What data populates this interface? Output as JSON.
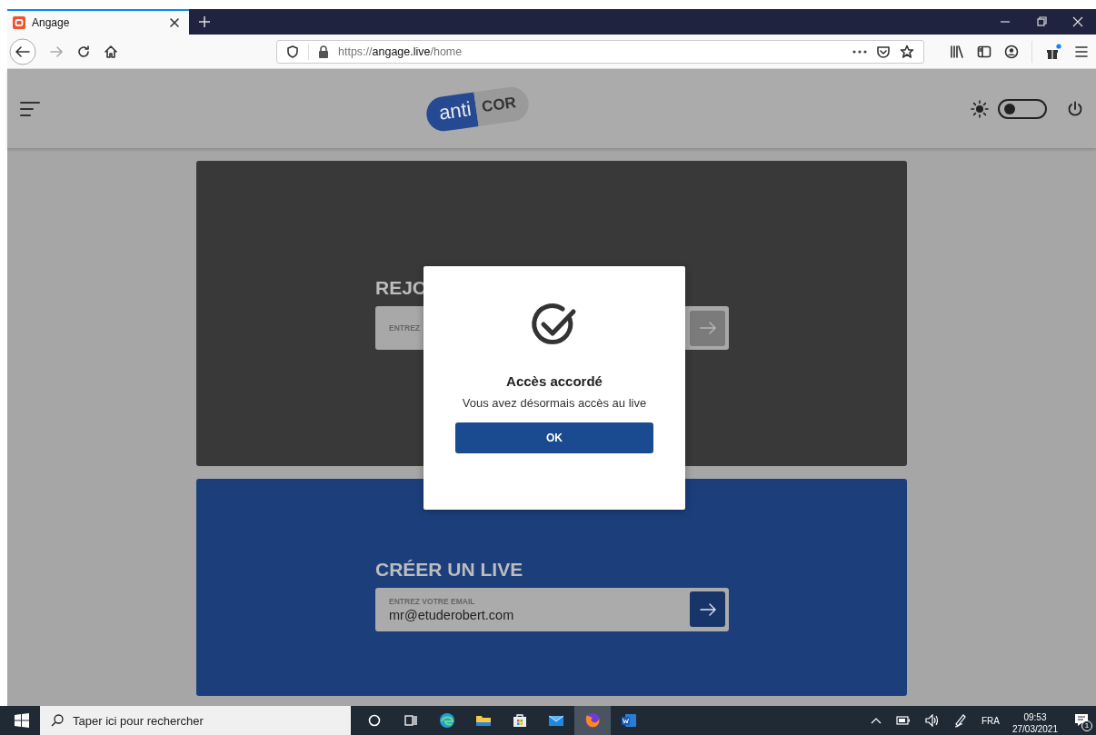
{
  "browser": {
    "tabs": [
      {
        "title": "Angage",
        "selected": true
      }
    ],
    "url": {
      "scheme": "https://",
      "host": "angage.live",
      "path": "/home"
    }
  },
  "app_header": {
    "logo": {
      "left": "anti",
      "right": "COR"
    },
    "theme_toggle": {
      "on": false
    }
  },
  "cards": [
    {
      "kind": "join",
      "title": "REJO",
      "field_label": "ENTREZ",
      "disabled": true
    },
    {
      "kind": "create",
      "title": "CRÉER UN LIVE",
      "field_label": "ENTREZ VOTRE EMAIL",
      "value": "mr@etuderobert.com",
      "disabled": false
    }
  ],
  "dialog": {
    "title": "Accès accordé",
    "message": "Vous avez désormais accès au live",
    "button": "OK"
  },
  "taskbar": {
    "search": {
      "placeholder": "Taper ici pour rechercher"
    },
    "apps": [
      {
        "kind": "cortana",
        "selected": false
      },
      {
        "kind": "task-view",
        "selected": false
      },
      {
        "kind": "edge",
        "selected": false
      },
      {
        "kind": "explorer",
        "selected": false
      },
      {
        "kind": "store",
        "selected": false
      },
      {
        "kind": "mail",
        "selected": false
      },
      {
        "kind": "firefox",
        "selected": true
      },
      {
        "kind": "word",
        "selected": false
      }
    ],
    "tray": {
      "language": "FRA",
      "time": "09:53",
      "date": "27/03/2021",
      "notifications": "1"
    }
  }
}
